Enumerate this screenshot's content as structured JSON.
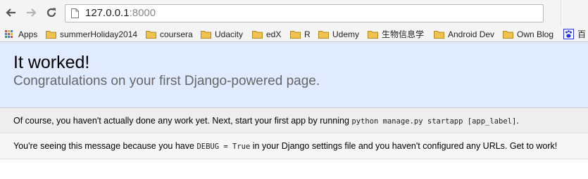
{
  "browser": {
    "url_host": "127.0.0.1",
    "url_port": ":8000",
    "bookmarks": [
      {
        "label": "Apps",
        "icon": "apps-grid-icon"
      },
      {
        "label": "summerHoliday2014",
        "icon": "folder-icon"
      },
      {
        "label": "coursera",
        "icon": "folder-icon"
      },
      {
        "label": "Udacity",
        "icon": "folder-icon"
      },
      {
        "label": "edX",
        "icon": "folder-icon"
      },
      {
        "label": "R",
        "icon": "folder-icon"
      },
      {
        "label": "Udemy",
        "icon": "folder-icon"
      },
      {
        "label": "生物信息学",
        "icon": "folder-icon"
      },
      {
        "label": "Android Dev",
        "icon": "folder-icon"
      },
      {
        "label": "Own Blog",
        "icon": "folder-icon"
      },
      {
        "label": "百",
        "icon": "baidu-paw-icon"
      }
    ]
  },
  "page": {
    "title": "It worked!",
    "subtitle": "Congratulations on your first Django-powered page.",
    "instructions": {
      "text_before": "Of course, you haven't actually done any work yet. Next, start your first app by running ",
      "code": "python manage.py startapp [app_label]",
      "text_after": "."
    },
    "explanation": {
      "text_before": "You're seeing this message because you have ",
      "code": "DEBUG = True",
      "text_after": " in your Django settings file and you haven't configured any URLs. Get to work!"
    }
  },
  "colors": {
    "summary_background": "#e0ebff",
    "instructions_background": "#eeeeee",
    "explanation_background": "#f6f6f6",
    "subtitle_text": "#666666",
    "folder_icon": "#f0c24f"
  }
}
